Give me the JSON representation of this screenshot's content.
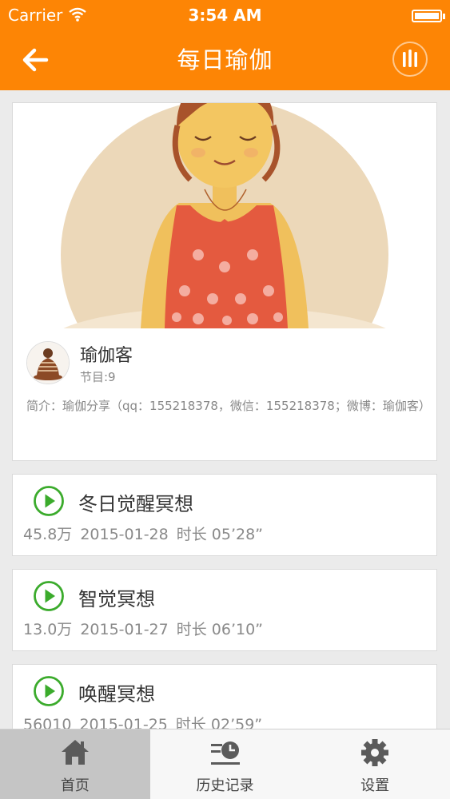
{
  "status_bar": {
    "carrier": "Carrier",
    "time": "3:54 AM"
  },
  "header": {
    "title": "每日瑜伽",
    "back_icon": "back-arrow-icon",
    "menu_icon": "equalizer-icon"
  },
  "album": {
    "author": "瑜伽客",
    "count": "节目:9",
    "intro": "简介：瑜伽分享（qq：155218378，微信：155218378；微博：瑜伽客）"
  },
  "tracks": [
    {
      "title": "冬日觉醒冥想",
      "plays": "45.8万",
      "date": "2015-01-28",
      "duration": "时长 05’28”"
    },
    {
      "title": "智觉冥想",
      "plays": "13.0万",
      "date": "2015-01-27",
      "duration": "时长 06’10”"
    },
    {
      "title": "唤醒冥想",
      "plays": "56010",
      "date": "2015-01-25",
      "duration": "时长 02’59”"
    }
  ],
  "tabbar": {
    "items": [
      {
        "label": "首页",
        "icon": "home-icon",
        "active": true
      },
      {
        "label": "历史记录",
        "icon": "history-icon",
        "active": false
      },
      {
        "label": "设置",
        "icon": "gear-icon",
        "active": false
      }
    ]
  },
  "colors": {
    "accent": "#fd8505",
    "play": "#3bab2c",
    "background": "#ebebeb"
  }
}
